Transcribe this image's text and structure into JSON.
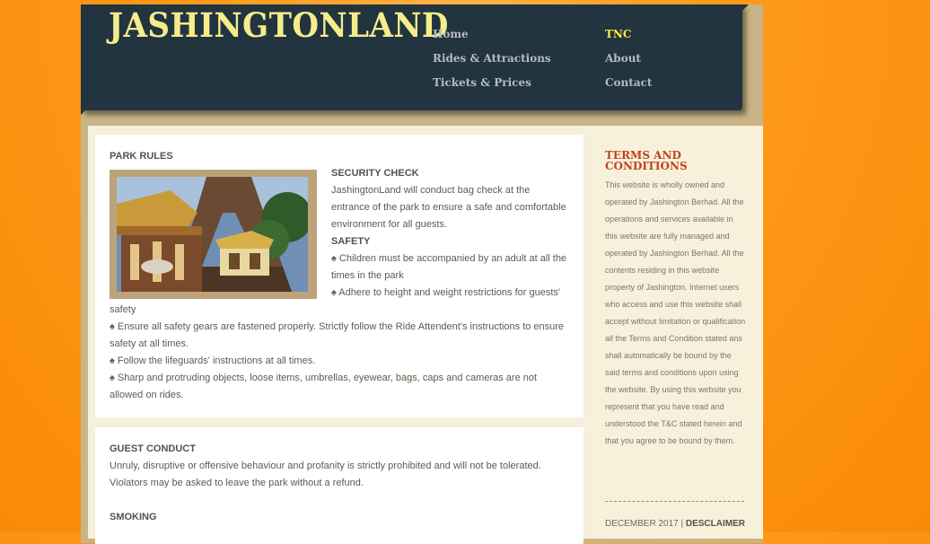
{
  "site": {
    "logo": "JASHINGTONLAND"
  },
  "nav": {
    "items": [
      {
        "label": "Home"
      },
      {
        "label": "Rides & Attractions"
      },
      {
        "label": "Tickets & Prices"
      },
      {
        "label": "TNC"
      },
      {
        "label": "About"
      },
      {
        "label": "Contact"
      }
    ],
    "active": "TNC"
  },
  "park_rules": {
    "title": "PARK RULES",
    "security_title": "SECURITY CHECK",
    "security_text": "JashingtonLand will conduct bag check at the entrance of the park to ensure a safe and comfortable environment for all guests.",
    "safety_title": "SAFETY",
    "safety_items": [
      "♠ Children must be accompanied by an adult at all the times in the park",
      "♠ Adhere to height and weight restrictions for guests' safety",
      "♠ Ensure all safety gears are fastened properly. Strictly follow the Ride Attendent's instructions to ensure safety at all times.",
      "♠ Follow the lifeguards' instructions at all times.",
      "♠ Sharp and protruding objects, loose items, umbrellas, eyewear, bags, caps and cameras are not allowed on rides."
    ]
  },
  "guest_conduct": {
    "title": "GUEST CONDUCT",
    "text": "Unruly, disruptive or offensive behaviour and profanity is strictly prohibited and will not be tolerated. Violators may be asked to leave the park without a refund.",
    "smoking_title": "SMOKING"
  },
  "sidebar": {
    "title": "TERMS AND CONDITIONS",
    "text": "This website is wholly owned and operated by Jashington Berhad. All the operations and services available in this website are fully managed and operated by Jashington Berhad. All the contents residing in this website property of Jashington. Internet users who access and use this website shall accept without limitation or qualification all the Terms and Condition stated ans shall automatically be bound by the said terms and conditions upon using the website. By using this website you represent that you have read and understood the T&C stated herein and that you agree to be bound by them.",
    "footer_date": "DECEMBER 2017 |",
    "footer_link": "DESCLAIMER"
  },
  "colors": {
    "header_bg": "#21343f",
    "logo": "#f6ec8b",
    "nav_active": "#f6ec3d",
    "sidebar_title": "#c0431a"
  }
}
